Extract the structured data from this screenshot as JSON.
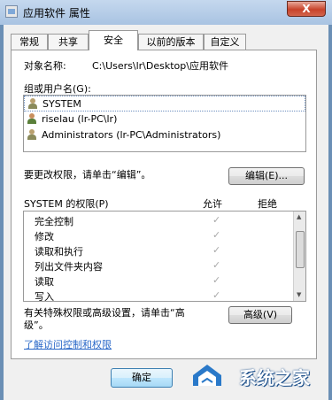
{
  "window": {
    "title": "应用软件 属性",
    "close_glyph": "X"
  },
  "tabs": [
    "常规",
    "共享",
    "安全",
    "以前的版本",
    "自定义"
  ],
  "security": {
    "object_name_label": "对象名称:",
    "object_name_value": "C:\\Users\\lr\\Desktop\\应用软件",
    "groups_label": "组或用户名(G):",
    "users": [
      {
        "name": "SYSTEM",
        "icon": "group-icon"
      },
      {
        "name": "riselau (lr-PC\\lr)",
        "icon": "user-icon"
      },
      {
        "name": "Administrators (lr-PC\\Administrators)",
        "icon": "group-icon"
      }
    ],
    "change_text": "要更改权限，请单击“编辑”。",
    "edit_button": "编辑(E)...",
    "perm_header": "SYSTEM 的权限(P)",
    "allow_label": "允许",
    "deny_label": "拒绝",
    "permissions": [
      "完全控制",
      "修改",
      "读取和执行",
      "列出文件夹内容",
      "读取",
      "写入"
    ],
    "check_glyph": "✓",
    "special_text_1": "有关特殊权限或高级设置，请单击“高",
    "special_text_2": "级”。",
    "advanced_button": "高级(V)",
    "link_text": "了解访问控制和权限"
  },
  "buttons": {
    "ok": "确定"
  },
  "watermark": {
    "text": "系统之家"
  },
  "colors": {
    "accent": "#2a68c8",
    "check": "#a8a8a8"
  }
}
